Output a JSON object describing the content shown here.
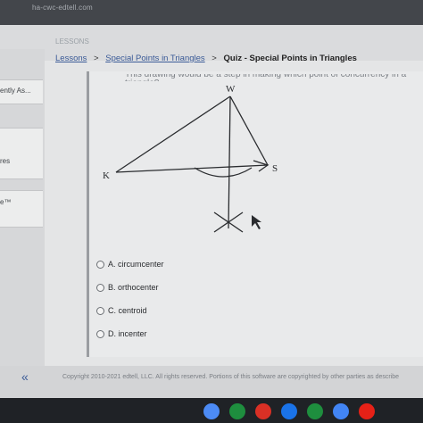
{
  "browser": {
    "url": "ha-cwc-edtell.com"
  },
  "header": {
    "faded_label": "LESSONS"
  },
  "breadcrumb": {
    "items": [
      "Lessons",
      "Special Points in Triangles"
    ],
    "current": "Quiz - Special Points in Triangles",
    "separator": ">"
  },
  "sidebar": {
    "items": [
      "ently As...",
      "res",
      "e™"
    ]
  },
  "question": {
    "partial_text": "This drawing would be a step in making which point of concurrency in a triangle?",
    "figure_labels": {
      "top": "W",
      "left": "K",
      "right": "S"
    }
  },
  "options": [
    {
      "label": "A. circumcenter",
      "selected": false
    },
    {
      "label": "B. orthocenter",
      "selected": false
    },
    {
      "label": "C. centroid",
      "selected": false
    },
    {
      "label": "D. incenter",
      "selected": false
    }
  ],
  "footer": {
    "collapse_glyph": "«",
    "copyright": "Copyright 2010-2021 edtell, LLC. All rights reserved. Portions of this software are copyrighted by other parties as describe"
  },
  "taskbar": {
    "apps": [
      {
        "icon": "chrome-icon",
        "color": "#4c8bf5"
      },
      {
        "icon": "meet-icon",
        "color": "#1e8e3e"
      },
      {
        "icon": "gmail-icon",
        "color": "#d93025"
      },
      {
        "icon": "files-icon",
        "color": "#1a73e8"
      },
      {
        "icon": "play-store-icon",
        "color": "#1e8e3e"
      },
      {
        "icon": "docs-icon",
        "color": "#4285f4"
      },
      {
        "icon": "youtube-icon",
        "color": "#e62117"
      }
    ]
  }
}
